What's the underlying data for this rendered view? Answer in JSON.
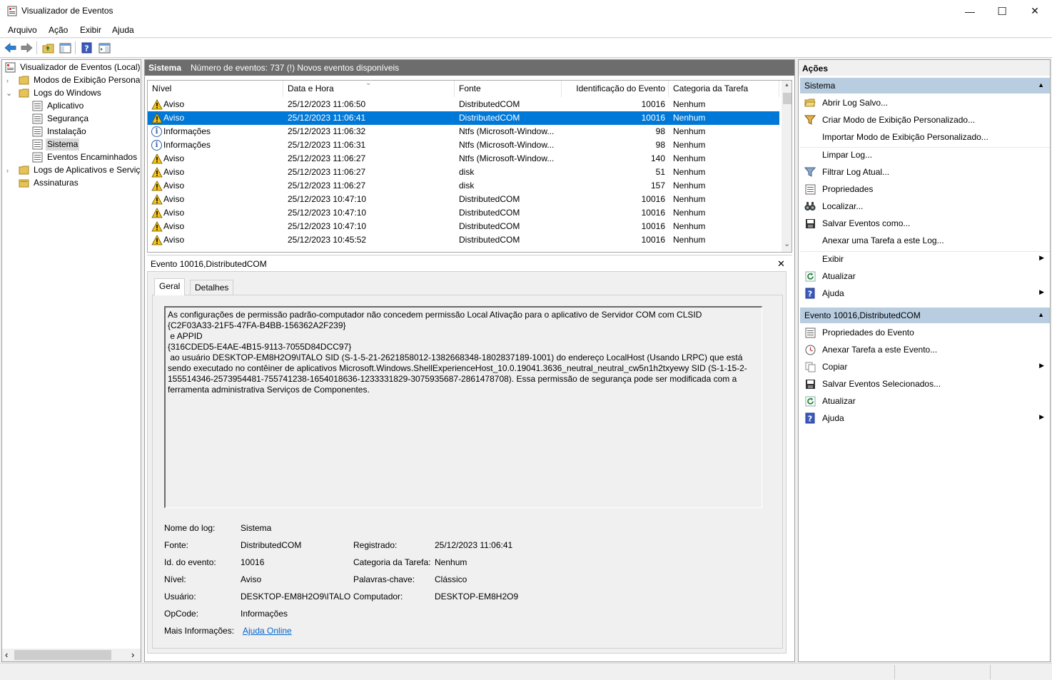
{
  "window": {
    "title": "Visualizador de Eventos",
    "minimize_glyph": "—",
    "maximize_glyph": "☐",
    "close_glyph": "✕"
  },
  "menu": [
    "Arquivo",
    "Ação",
    "Exibir",
    "Ajuda"
  ],
  "toolbar": {
    "icons": [
      "back-arrow-icon",
      "forward-arrow-icon",
      "folder-up-icon",
      "show-hide-console-tree-icon",
      "help-icon",
      "show-hide-action-pane-icon"
    ]
  },
  "tree": {
    "root": "Visualizador de Eventos (Local)",
    "custom_views": "Modos de Exibição Personalizados",
    "windows_logs": "Logs do Windows",
    "children": [
      "Aplicativo",
      "Segurança",
      "Instalação",
      "Sistema",
      "Eventos Encaminhados"
    ],
    "app_logs": "Logs de Aplicativos e Serviços",
    "subscriptions": "Assinaturas",
    "selected": "Sistema",
    "arrow_right": "›",
    "arrow_down": "⌄",
    "hscroll_left": "‹",
    "hscroll_right": "›"
  },
  "center": {
    "header_title": "Sistema",
    "header_info": "Número de eventos: 737 (!) Novos eventos disponíveis",
    "columns": [
      "Nível",
      "Data e Hora",
      "Fonte",
      "Identificação do Evento",
      "Categoria da Tarefa"
    ],
    "sort_glyph": "⌄",
    "scroll_up": "▲",
    "scroll_down": "⌄",
    "rows": [
      {
        "level": "Aviso",
        "type": "warning",
        "date": "25/12/2023 11:06:50",
        "source": "DistributedCOM",
        "id": "10016",
        "category": "Nenhum"
      },
      {
        "level": "Aviso",
        "type": "warning",
        "date": "25/12/2023 11:06:41",
        "source": "DistributedCOM",
        "id": "10016",
        "category": "Nenhum",
        "selected": true
      },
      {
        "level": "Informações",
        "type": "info",
        "date": "25/12/2023 11:06:32",
        "source": "Ntfs (Microsoft-Window...",
        "id": "98",
        "category": "Nenhum"
      },
      {
        "level": "Informações",
        "type": "info",
        "date": "25/12/2023 11:06:31",
        "source": "Ntfs (Microsoft-Window...",
        "id": "98",
        "category": "Nenhum"
      },
      {
        "level": "Aviso",
        "type": "warning",
        "date": "25/12/2023 11:06:27",
        "source": "Ntfs (Microsoft-Window...",
        "id": "140",
        "category": "Nenhum"
      },
      {
        "level": "Aviso",
        "type": "warning",
        "date": "25/12/2023 11:06:27",
        "source": "disk",
        "id": "51",
        "category": "Nenhum"
      },
      {
        "level": "Aviso",
        "type": "warning",
        "date": "25/12/2023 11:06:27",
        "source": "disk",
        "id": "157",
        "category": "Nenhum"
      },
      {
        "level": "Aviso",
        "type": "warning",
        "date": "25/12/2023 10:47:10",
        "source": "DistributedCOM",
        "id": "10016",
        "category": "Nenhum"
      },
      {
        "level": "Aviso",
        "type": "warning",
        "date": "25/12/2023 10:47:10",
        "source": "DistributedCOM",
        "id": "10016",
        "category": "Nenhum"
      },
      {
        "level": "Aviso",
        "type": "warning",
        "date": "25/12/2023 10:47:10",
        "source": "DistributedCOM",
        "id": "10016",
        "category": "Nenhum"
      },
      {
        "level": "Aviso",
        "type": "warning",
        "date": "25/12/2023 10:45:52",
        "source": "DistributedCOM",
        "id": "10016",
        "category": "Nenhum"
      }
    ]
  },
  "detail": {
    "title": "Evento 10016,DistributedCOM",
    "close_glyph": "✕",
    "tabs": [
      "Geral",
      "Detalhes"
    ],
    "active_tab": "Geral",
    "description": "As configurações de permissão padrão-computador não concedem permissão Local Ativação para o aplicativo de Servidor COM com CLSID\n{C2F03A33-21F5-47FA-B4BB-156362A2F239}\n e APPID\n{316CDED5-E4AE-4B15-9113-7055D84DCC97}\n ao usuário DESKTOP-EM8H2O9\\ITALO SID (S-1-5-21-2621858012-1382668348-1802837189-1001) do endereço LocalHost (Usando LRPC) que está sendo executado no contêiner de aplicativos Microsoft.Windows.ShellExperienceHost_10.0.19041.3636_neutral_neutral_cw5n1h2txyewy SID (S-1-15-2-155514346-2573954481-755741238-1654018636-1233331829-3075935687-2861478708). Essa permissão de segurança pode ser modificada com a ferramenta administrativa Serviços de Componentes.",
    "props": {
      "log_name_label": "Nome do log:",
      "log_name": "Sistema",
      "source_label": "Fonte:",
      "source": "DistributedCOM",
      "logged_label": "Registrado:",
      "logged": "25/12/2023 11:06:41",
      "event_id_label": "Id. do evento:",
      "event_id": "10016",
      "task_label": "Categoria da Tarefa:",
      "task": "Nenhum",
      "level_label": "Nível:",
      "level": "Aviso",
      "keywords_label": "Palavras-chave:",
      "keywords": "Clássico",
      "user_label": "Usuário:",
      "user": "DESKTOP-EM8H2O9\\ITALO",
      "computer_label": "Computador:",
      "computer": "DESKTOP-EM8H2O9",
      "opcode_label": "OpCode:",
      "opcode": "Informações",
      "more_info_label": "Mais Informações:",
      "more_info_link": "Ajuda Online"
    }
  },
  "actions": {
    "title": "Ações",
    "section1": "Sistema",
    "section1_items": [
      {
        "label": "Abrir Log Salvo...",
        "icon": "open-folder-icon"
      },
      {
        "label": "Criar Modo de Exibição Personalizado...",
        "icon": "filter-create-icon"
      },
      {
        "label": "Importar Modo de Exibição Personalizado...",
        "icon": ""
      },
      {
        "label": "Limpar Log...",
        "icon": ""
      },
      {
        "label": "Filtrar Log Atual...",
        "icon": "filter-icon"
      },
      {
        "label": "Propriedades",
        "icon": "properties-icon"
      },
      {
        "label": "Localizar...",
        "icon": "binoculars-icon"
      },
      {
        "label": "Salvar Eventos como...",
        "icon": "save-icon"
      },
      {
        "label": "Anexar uma Tarefa a este Log...",
        "icon": ""
      },
      {
        "label": "Exibir",
        "icon": "",
        "submenu": true
      },
      {
        "label": "Atualizar",
        "icon": "refresh-icon"
      },
      {
        "label": "Ajuda",
        "icon": "help-icon",
        "submenu": true
      }
    ],
    "section2": "Evento 10016,DistributedCOM",
    "section2_items": [
      {
        "label": "Propriedades do Evento",
        "icon": "properties-icon"
      },
      {
        "label": "Anexar Tarefa a este Evento...",
        "icon": "clock-task-icon"
      },
      {
        "label": "Copiar",
        "icon": "copy-icon",
        "submenu": true
      },
      {
        "label": "Salvar Eventos Selecionados...",
        "icon": "save-icon"
      },
      {
        "label": "Atualizar",
        "icon": "refresh-icon"
      },
      {
        "label": "Ajuda",
        "icon": "help-icon",
        "submenu": true
      }
    ],
    "collapse_glyph": "▲",
    "submenu_glyph": "▶"
  },
  "colors": {
    "selection": "#0078d7",
    "section_header": "#b8cde0",
    "panel_header": "#6d6d6d",
    "link": "#0066cc",
    "warning": "#f4c21b"
  }
}
